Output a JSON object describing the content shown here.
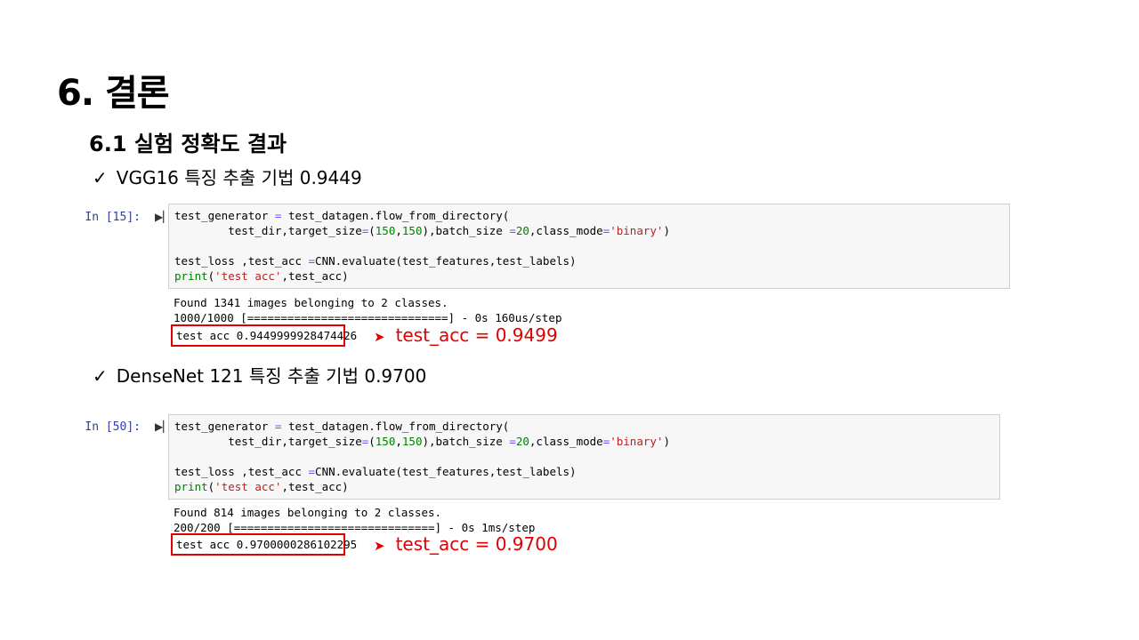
{
  "title": "6. 결론",
  "subtitle": "6.1 실험 정확도 결과",
  "checkmark": "✓",
  "arrow": "➤",
  "items": [
    {
      "label": "VGG16 특징 추출 기법 0.9449",
      "prompt": "In [15]:",
      "output_lines": [
        "Found 1341 images belonging to 2 classes.",
        "1000/1000 [==============================] - 0s 160us/step"
      ],
      "result": "test acc 0.9449999928474426",
      "annotation": "test_acc  =  0.9499"
    },
    {
      "label": "DenseNet 121 특징 추출 기법 0.9700",
      "prompt": "In [50]:",
      "output_lines": [
        "Found 814 images belonging to 2 classes.",
        "200/200 [==============================] - 0s 1ms/step"
      ],
      "result": "test acc 0.9700000286102295",
      "annotation": "test_acc  =  0.9700"
    }
  ],
  "code": {
    "t_test_generator": "test_generator",
    "t_eq": "=",
    "t_flow": " test_datagen.flow_from_directory(",
    "t_indent_dir": "        test_dir,target_size",
    "t_paren_open": "(",
    "t_150a": "150",
    "t_comma": ",",
    "t_150b": "150",
    "t_batch": "),batch_size ",
    "t_20": "20",
    "t_classmode": ",class_mode",
    "t_binary": "'binary'",
    "t_close": ")",
    "t_loss_line": "test_loss ,test_acc ",
    "t_cnn": "CNN.evaluate(test_features,test_labels)",
    "t_print": "print",
    "t_test_acc_str": "'test acc'",
    "t_print_rest": ",test_acc)"
  },
  "colors": {
    "accent_red": "#e00000",
    "prompt_blue": "#303F9F",
    "string_red": "#ba2121",
    "number_green": "#008000",
    "operator_purple": "#7c4dff"
  }
}
